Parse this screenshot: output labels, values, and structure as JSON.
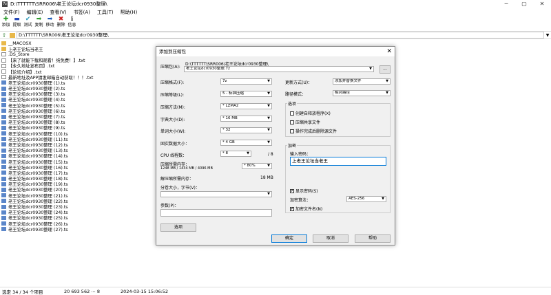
{
  "window": {
    "title": "D:\\TTTTTT\\SRR006\\老王论坛dcr0930整理\\",
    "app_icon": "7z"
  },
  "menu": [
    "文件(F)",
    "编辑(E)",
    "查看(V)",
    "书签(A)",
    "工具(T)",
    "帮助(H)"
  ],
  "toolbar": [
    {
      "label": "添加",
      "icon": "plus-icon",
      "glyph": "✚",
      "color": "#2a9a2a"
    },
    {
      "label": "提取",
      "icon": "minus-icon",
      "glyph": "▬",
      "color": "#2548b8"
    },
    {
      "label": "测试",
      "icon": "check-icon",
      "glyph": "✔",
      "color": "#2a9abb"
    },
    {
      "label": "复制",
      "icon": "copy-arrow-icon",
      "glyph": "➡",
      "color": "#2a9a2a"
    },
    {
      "label": "移动",
      "icon": "move-arrow-icon",
      "glyph": "➡",
      "color": "#1a5ab8"
    },
    {
      "label": "删除",
      "icon": "delete-icon",
      "glyph": "✖",
      "color": "#cc2222"
    },
    {
      "label": "信息",
      "icon": "info-icon",
      "glyph": "ℹ",
      "color": "#333333"
    }
  ],
  "address": "D:\\TTTTTT\\SRR006\\老王论坛dcr0930整理\\",
  "files": [
    {
      "name": "__MACOSX",
      "type": "folder"
    },
    {
      "name": "上老王论坛当老王",
      "type": "folder"
    },
    {
      "name": ".DS_Store",
      "type": "txt"
    },
    {
      "name": "【来了就能下载和观看！纯免费！】.txt",
      "type": "txt"
    },
    {
      "name": "【永久地址发布页】.txt",
      "type": "txt"
    },
    {
      "name": "【论坛介绍】.txt",
      "type": "txt"
    },
    {
      "name": "最新地址及APP請发邮箱自动获取！！！.txt",
      "type": "txt"
    },
    {
      "name": "老王论坛dcr0930整理 (1).ts",
      "type": "ts"
    },
    {
      "name": "老王论坛dcr0930整理 (2).ts",
      "type": "ts"
    },
    {
      "name": "老王论坛dcr0930整理 (3).ts",
      "type": "ts"
    },
    {
      "name": "老王论坛dcr0930整理 (4).ts",
      "type": "ts"
    },
    {
      "name": "老王论坛dcr0930整理 (5).ts",
      "type": "ts"
    },
    {
      "name": "老王论坛dcr0930整理 (6).ts",
      "type": "ts"
    },
    {
      "name": "老王论坛dcr0930整理 (7).ts",
      "type": "ts"
    },
    {
      "name": "老王论坛dcr0930整理 (8).ts",
      "type": "ts"
    },
    {
      "name": "老王论坛dcr0930整理 (9).ts",
      "type": "ts"
    },
    {
      "name": "老王论坛dcr0930整理 (10).ts",
      "type": "ts"
    },
    {
      "name": "老王论坛dcr0930整理 (11).ts",
      "type": "ts"
    },
    {
      "name": "老王论坛dcr0930整理 (12).ts",
      "type": "ts"
    },
    {
      "name": "老王论坛dcr0930整理 (13).ts",
      "type": "ts"
    },
    {
      "name": "老王论坛dcr0930整理 (14).ts",
      "type": "ts"
    },
    {
      "name": "老王论坛dcr0930整理 (15).ts",
      "type": "ts"
    },
    {
      "name": "老王论坛dcr0930整理 (16).ts",
      "type": "ts"
    },
    {
      "name": "老王论坛dcr0930整理 (17).ts",
      "type": "ts"
    },
    {
      "name": "老王论坛dcr0930整理 (18).ts",
      "type": "ts"
    },
    {
      "name": "老王论坛dcr0930整理 (19).ts",
      "type": "ts"
    },
    {
      "name": "老王论坛dcr0930整理 (20).ts",
      "type": "ts"
    },
    {
      "name": "老王论坛dcr0930整理 (21).ts",
      "type": "ts"
    },
    {
      "name": "老王论坛dcr0930整理 (22).ts",
      "type": "ts"
    },
    {
      "name": "老王论坛dcr0930整理 (23).ts",
      "type": "ts"
    },
    {
      "name": "老王论坛dcr0930整理 (24).ts",
      "type": "ts"
    },
    {
      "name": "老王论坛dcr0930整理 (25).ts",
      "type": "ts"
    },
    {
      "name": "老王论坛dcr0930整理 (26).ts",
      "type": "ts"
    },
    {
      "name": "老王论坛dcr0930整理 (27).ts",
      "type": "ts"
    }
  ],
  "status": {
    "selection": "选定 34 / 34 个项目",
    "size": "20 693 562 ⋯ 8",
    "date": "2024-03-15 15:06:52"
  },
  "dialog": {
    "title": "添加到压缩包",
    "archive_label": "压缩包(A):",
    "archive_dir": "D:\\TTTTTT\\SRR006\\老王论坛dcr0930整理\\",
    "archive_name": "老王论坛dcr0930整理.7z",
    "browse": "...",
    "format_label": "压缩格式(F):",
    "format": "7z",
    "level_label": "压缩等级(L):",
    "level": "5 - 标准压缩",
    "method_label": "压缩方法(M):",
    "method": "* LZMA2",
    "dict_label": "字典大小(D):",
    "dict": "* 16 MB",
    "word_label": "单词大小(W):",
    "word": "* 32",
    "solid_label": "固实数据大小：",
    "solid": "* 4 GB",
    "cpu_label": "CPU 线程数：",
    "cpu": "* 8",
    "cpu_total": "/ 8",
    "mem_label": "压缩所需内存：",
    "mem_detail": "1248 MB / 1434 MB / 4096 MB",
    "mem_pct": "* 80%",
    "decomp_label": "解压缩所需内存：",
    "decomp": "18 MB",
    "split_label": "分卷大小，字节(V)：",
    "split": "",
    "params_label": "参数(P)：",
    "params": "",
    "options_btn": "选项",
    "update_label": "更新方式(U)：",
    "update": "添加并替换文件",
    "path_label": "路径模式：",
    "path_mode": "相对路径",
    "opts_title": "选项",
    "opts": [
      {
        "label": "创建自释放程序(X)",
        "checked": false
      },
      {
        "label": "压缩共享文件",
        "checked": false
      },
      {
        "label": "操作完成后删除源文件",
        "checked": false
      }
    ],
    "enc_title": "加密",
    "pwd_label": "输入密码：",
    "pwd": "上老王论坛当老王",
    "show_pwd": "显示密码(S)",
    "show_pwd_checked": true,
    "enc_method_label": "加密算法：",
    "enc_method": "AES-256",
    "enc_names": "加密文件名(N)",
    "enc_names_checked": true,
    "ok": "确定",
    "cancel": "取消",
    "help": "帮助"
  }
}
